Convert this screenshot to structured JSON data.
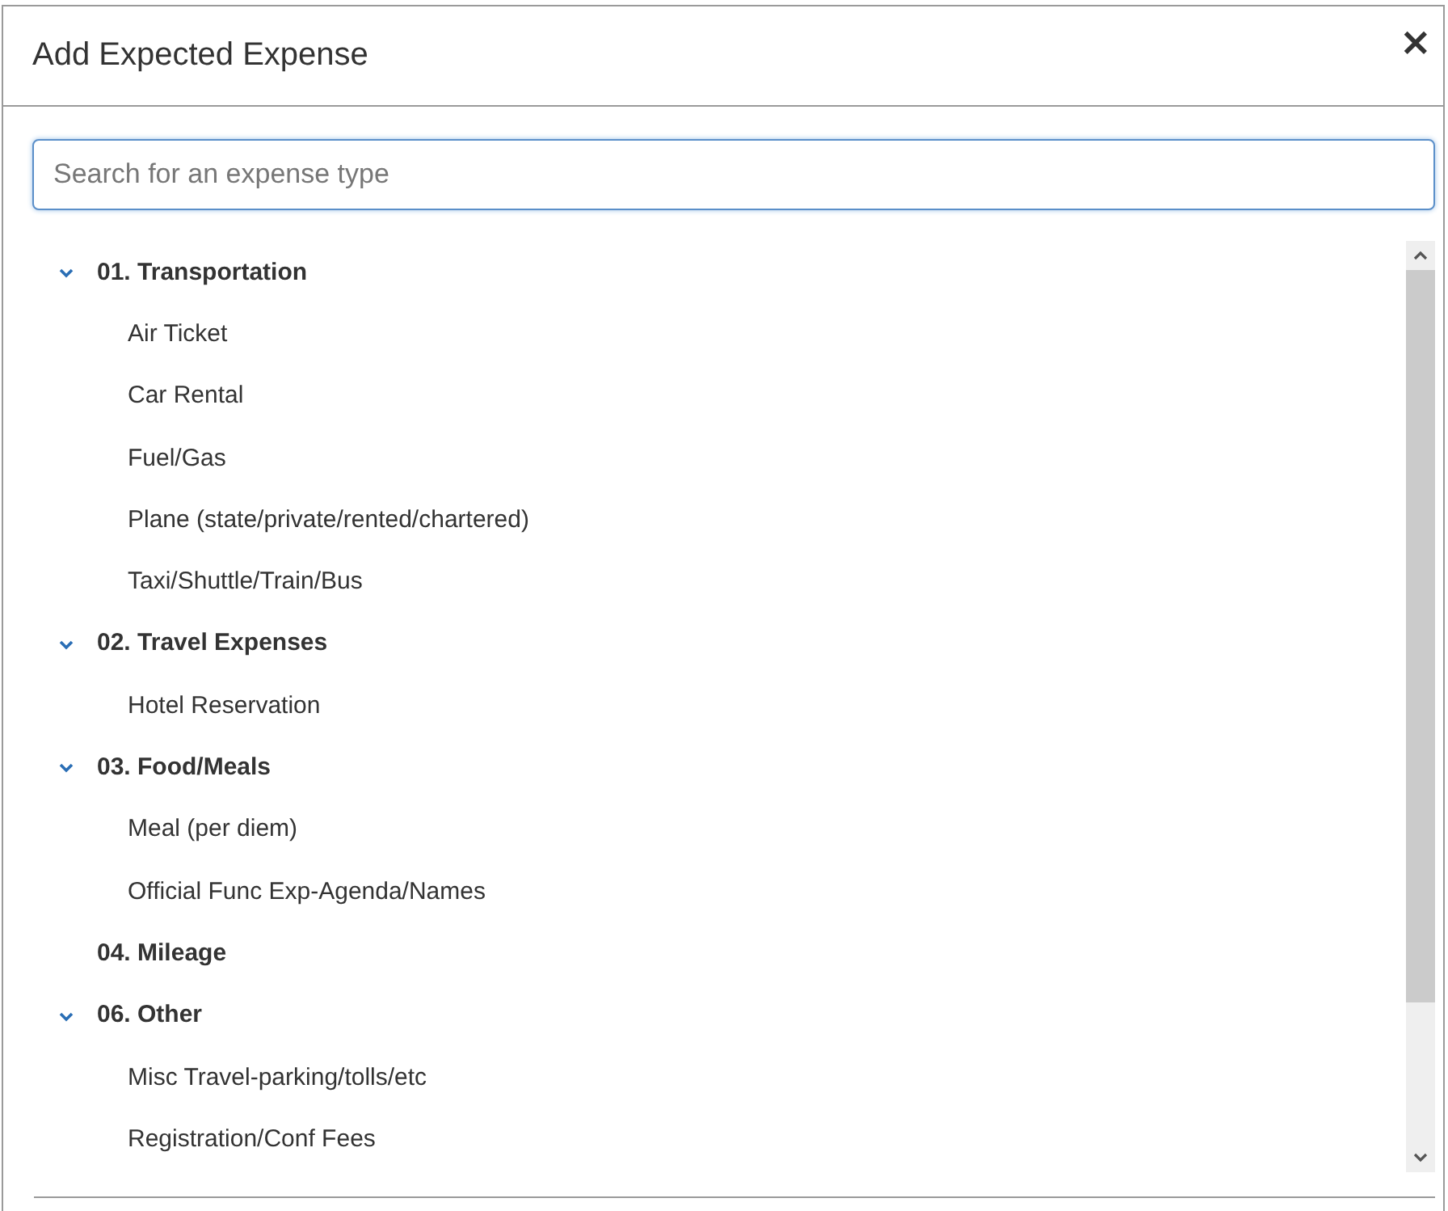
{
  "dialog": {
    "title": "Add Expected Expense",
    "close": "×"
  },
  "search": {
    "placeholder": "Search for an expense type"
  },
  "groups": [
    {
      "label": "01. Transportation",
      "expanded": true,
      "children": [
        {
          "label": "Air Ticket"
        },
        {
          "label": "Car Rental"
        },
        {
          "label": "Fuel/Gas"
        },
        {
          "label": "Plane (state/private/rented/chartered)"
        },
        {
          "label": "Taxi/Shuttle/Train/Bus"
        }
      ]
    },
    {
      "label": "02. Travel Expenses",
      "expanded": true,
      "children": [
        {
          "label": "Hotel Reservation"
        }
      ]
    },
    {
      "label": "03. Food/Meals",
      "expanded": true,
      "children": [
        {
          "label": "Meal (per diem)"
        },
        {
          "label": "Official Func Exp-Agenda/Names"
        }
      ]
    },
    {
      "label": "04. Mileage"
    },
    {
      "label": "06. Other",
      "expanded": true,
      "children": [
        {
          "label": "Misc Travel-parking/tolls/etc"
        },
        {
          "label": "Registration/Conf Fees"
        }
      ]
    }
  ]
}
